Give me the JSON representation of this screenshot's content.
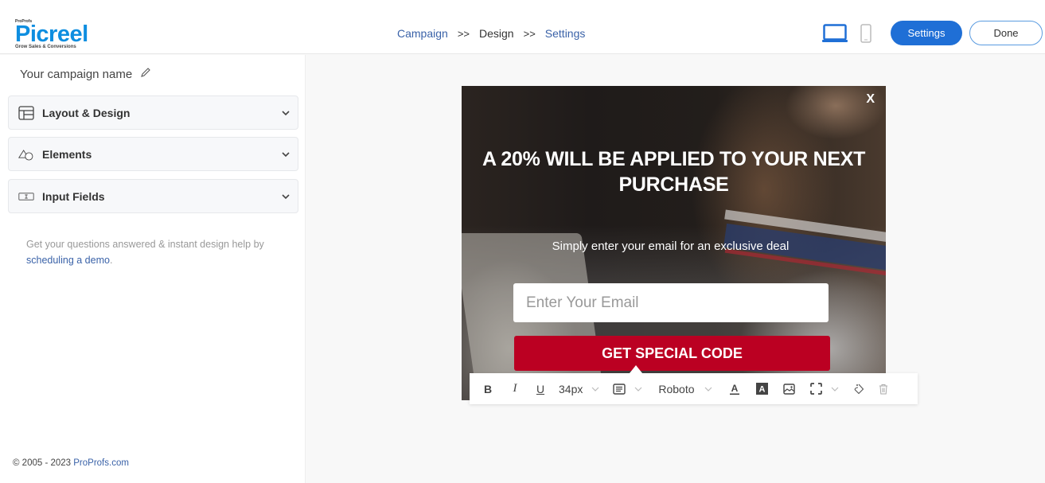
{
  "header": {
    "logo": {
      "brand_small": "ProProfs",
      "name": "Picreel",
      "tagline": "Grow Sales & Conversions"
    },
    "breadcrumb": [
      {
        "label": "Campaign"
      },
      {
        "label": ">>"
      },
      {
        "label": "Design"
      },
      {
        "label": ">>"
      },
      {
        "label": "Settings"
      }
    ],
    "device_icons": [
      "laptop-icon",
      "phone-icon"
    ],
    "settings_label": "Settings",
    "done_label": "Done",
    "accent_color": "#1f6fd6"
  },
  "sidebar": {
    "campaign_name": "Your campaign name",
    "sections": [
      {
        "label": "Layout & Design",
        "icon": "layout-icon"
      },
      {
        "label": "Elements",
        "icon": "shapes-icon"
      },
      {
        "label": "Input Fields",
        "icon": "input-field-icon"
      }
    ],
    "help_text": "Get your questions answered & instant design help by",
    "help_link": "scheduling a demo",
    "help_end": ".",
    "copyright": "© 2005 - 2023",
    "copyright_link": "ProProfs.com"
  },
  "popup": {
    "close_label": "X",
    "headline": "A 20% WILL BE APPLIED TO YOUR NEXT PURCHASE",
    "subtext": "Simply enter your email for an exclusive deal",
    "email_placeholder": "Enter Your Email",
    "cta_label": "GET SPECIAL CODE",
    "cta_color": "#bb0022"
  },
  "toolbar": {
    "bold": "B",
    "italic": "I",
    "underline": "U",
    "font_size": "34px",
    "font_family": "Roboto",
    "chevron": "⌵"
  }
}
